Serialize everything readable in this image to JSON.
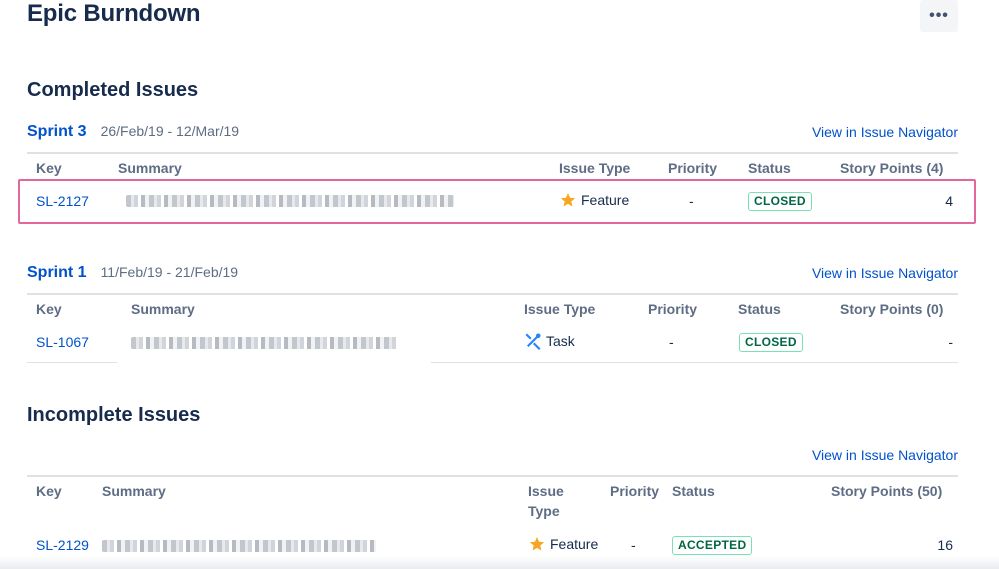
{
  "page": {
    "title": "Epic Burndown",
    "more_label": "•••"
  },
  "completed": {
    "heading": "Completed Issues",
    "sprints": [
      {
        "name": "Sprint 3",
        "dates": "26/Feb/19 - 12/Mar/19",
        "nav_link": "View in Issue Navigator",
        "headers": {
          "key": "Key",
          "summary": "Summary",
          "issue_type": "Issue Type",
          "priority": "Priority",
          "status": "Status",
          "story_points": "Story Points (4)"
        },
        "rows": [
          {
            "key": "SL-2127",
            "issue_type": "Feature",
            "issue_type_icon": "star-icon",
            "priority": "-",
            "status": "CLOSED",
            "story_points": "4"
          }
        ]
      },
      {
        "name": "Sprint 1",
        "dates": "11/Feb/19 - 21/Feb/19",
        "nav_link": "View in Issue Navigator",
        "headers": {
          "key": "Key",
          "summary": "Summary",
          "issue_type": "Issue Type",
          "priority": "Priority",
          "status": "Status",
          "story_points": "Story Points (0)"
        },
        "rows": [
          {
            "key": "SL-1067",
            "issue_type": "Task",
            "issue_type_icon": "wrench-icon",
            "priority": "-",
            "status": "CLOSED",
            "story_points": "-"
          }
        ]
      }
    ]
  },
  "incomplete": {
    "heading": "Incomplete Issues",
    "nav_link": "View in Issue Navigator",
    "headers": {
      "key": "Key",
      "summary": "Summary",
      "issue_type_line1": "Issue",
      "issue_type_line2": "Type",
      "priority": "Priority",
      "status": "Status",
      "story_points": "Story Points (50)"
    },
    "rows": [
      {
        "key": "SL-2129",
        "issue_type": "Feature",
        "issue_type_icon": "star-icon",
        "priority": "-",
        "status": "ACCEPTED",
        "story_points": "16"
      }
    ]
  },
  "colors": {
    "link": "#0052cc",
    "heading": "#172b4d",
    "status_green": "#006644",
    "highlight_border": "#e3679a",
    "feature_star": "#f6a623",
    "task_icon": "#2684ff"
  }
}
